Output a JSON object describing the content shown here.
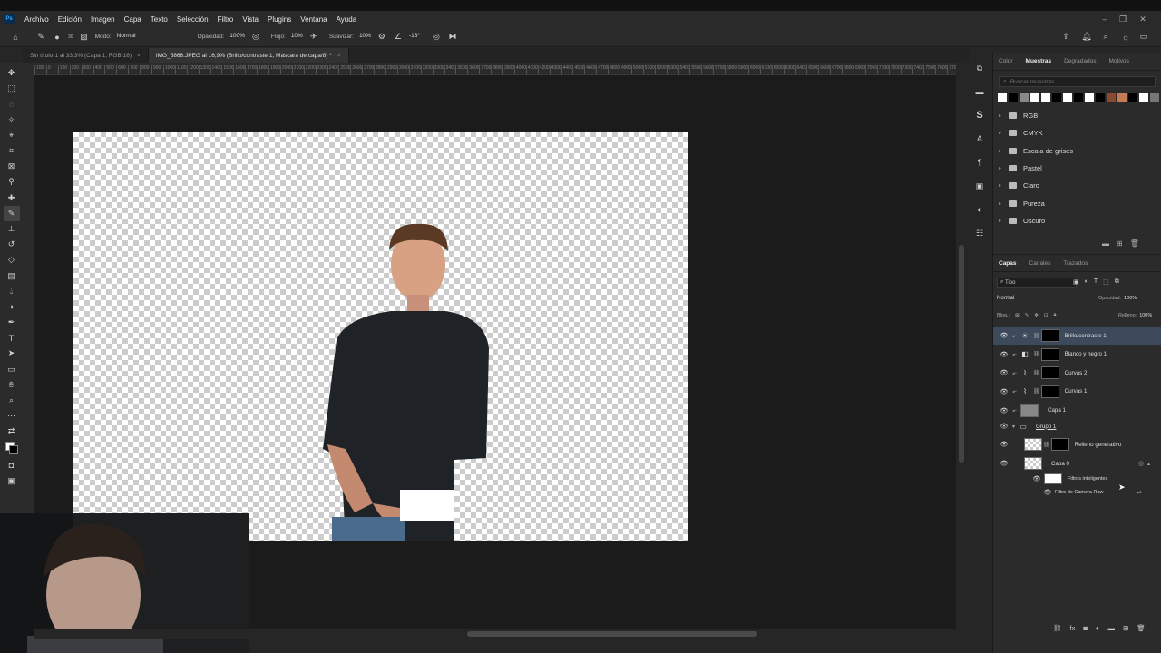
{
  "app": {
    "logo": "Ps"
  },
  "menu": [
    "Archivo",
    "Edición",
    "Imagen",
    "Capa",
    "Texto",
    "Selección",
    "Filtro",
    "Vista",
    "Plugins",
    "Ventana",
    "Ayuda"
  ],
  "options": {
    "mode_label": "Modo:",
    "mode_value": "Normal",
    "opacity_label": "Opacidad:",
    "opacity_value": "100%",
    "flow_label": "Flujo:",
    "flow_value": "10%",
    "smooth_label": "Suavizar:",
    "smooth_value": "10%",
    "angle_value": "-16°",
    "brush_size": "30"
  },
  "tabs": [
    {
      "label": "Sin título-1 al 33,3% (Capa 1, RGB/16)"
    },
    {
      "label": "IMG_5866.JPEG al 16,9% (Brillo/contraste 1, Máscara de capa/8) *"
    }
  ],
  "ruler_ticks": [
    "100",
    "0",
    "100",
    "200",
    "300",
    "400",
    "500",
    "600",
    "700",
    "800",
    "900",
    "1000",
    "1100",
    "1200",
    "1300",
    "1400",
    "1500",
    "1600",
    "1700",
    "1800",
    "1900",
    "2000",
    "2100",
    "2200",
    "2300",
    "2400",
    "2500",
    "2600",
    "2700",
    "2800",
    "2900",
    "3000",
    "3100",
    "3200",
    "3300",
    "3400",
    "3500",
    "3600",
    "3700",
    "3800",
    "3900",
    "4000",
    "4100",
    "4200",
    "4300",
    "4400",
    "4500",
    "4600",
    "4700",
    "4800",
    "4900",
    "5000",
    "5100",
    "5200",
    "5300",
    "5400",
    "5500",
    "5600",
    "5700",
    "5800",
    "5900",
    "6000",
    "6100",
    "6200",
    "6300",
    "6400",
    "6500",
    "6600",
    "6700",
    "6800",
    "6900",
    "7000",
    "7100",
    "7200",
    "7300",
    "7400",
    "7500",
    "7600",
    "7700",
    "7800"
  ],
  "swatches_panel": {
    "tabs": [
      "Color",
      "Muestras",
      "Degradados",
      "Motivos"
    ],
    "active_tab": "Muestras",
    "search_placeholder": "Buscar muestras",
    "swatch_colors": [
      "#ffffff",
      "#000000",
      "#888888",
      "#ffffff",
      "#ffffff",
      "#000000",
      "#ffffff",
      "#000000",
      "#ffffff",
      "#000000",
      "#8b4a2e",
      "#c87a52",
      "#000000",
      "#ffffff",
      "#777777"
    ],
    "folders": [
      "RGB",
      "CMYK",
      "Escala de grises",
      "Pastel",
      "Claro",
      "Pureza",
      "Oscuro"
    ]
  },
  "layers_panel": {
    "tabs": [
      "Capas",
      "Canales",
      "Trazados"
    ],
    "active_tab": "Capas",
    "filter_label": "Tipo",
    "blend_mode": "Normal",
    "opacity_label": "Opacidad:",
    "opacity_value": "100%",
    "lock_label": "Bloq.:",
    "fill_label": "Relleno:",
    "fill_value": "100%",
    "layers": [
      {
        "name": "Brillo/contraste 1",
        "icon": "sun-icon",
        "thumb": "black",
        "selected": true
      },
      {
        "name": "Blanco y negro 1",
        "icon": "half-square-icon",
        "thumb": "black",
        "selected": false
      },
      {
        "name": "Curvas 2",
        "icon": "curves-icon",
        "thumb": "black",
        "selected": false
      },
      {
        "name": "Curvas 1",
        "icon": "curves-icon",
        "thumb": "black",
        "selected": false
      },
      {
        "name": "Capa 1",
        "icon": "",
        "thumb": "gray",
        "selected": false
      },
      {
        "name": "Grupo 1",
        "icon": "folder-icon",
        "thumb": "",
        "selected": false
      },
      {
        "name": "Relleno generativo",
        "icon": "",
        "thumb": "check",
        "selected": false
      },
      {
        "name": "Capa 0",
        "icon": "",
        "thumb": "check",
        "selected": false
      },
      {
        "name": "Filtros inteligentes",
        "icon": "",
        "thumb": "white",
        "selected": false
      },
      {
        "name": "Filtro de Camera Raw",
        "icon": "",
        "thumb": "",
        "selected": false
      }
    ]
  }
}
